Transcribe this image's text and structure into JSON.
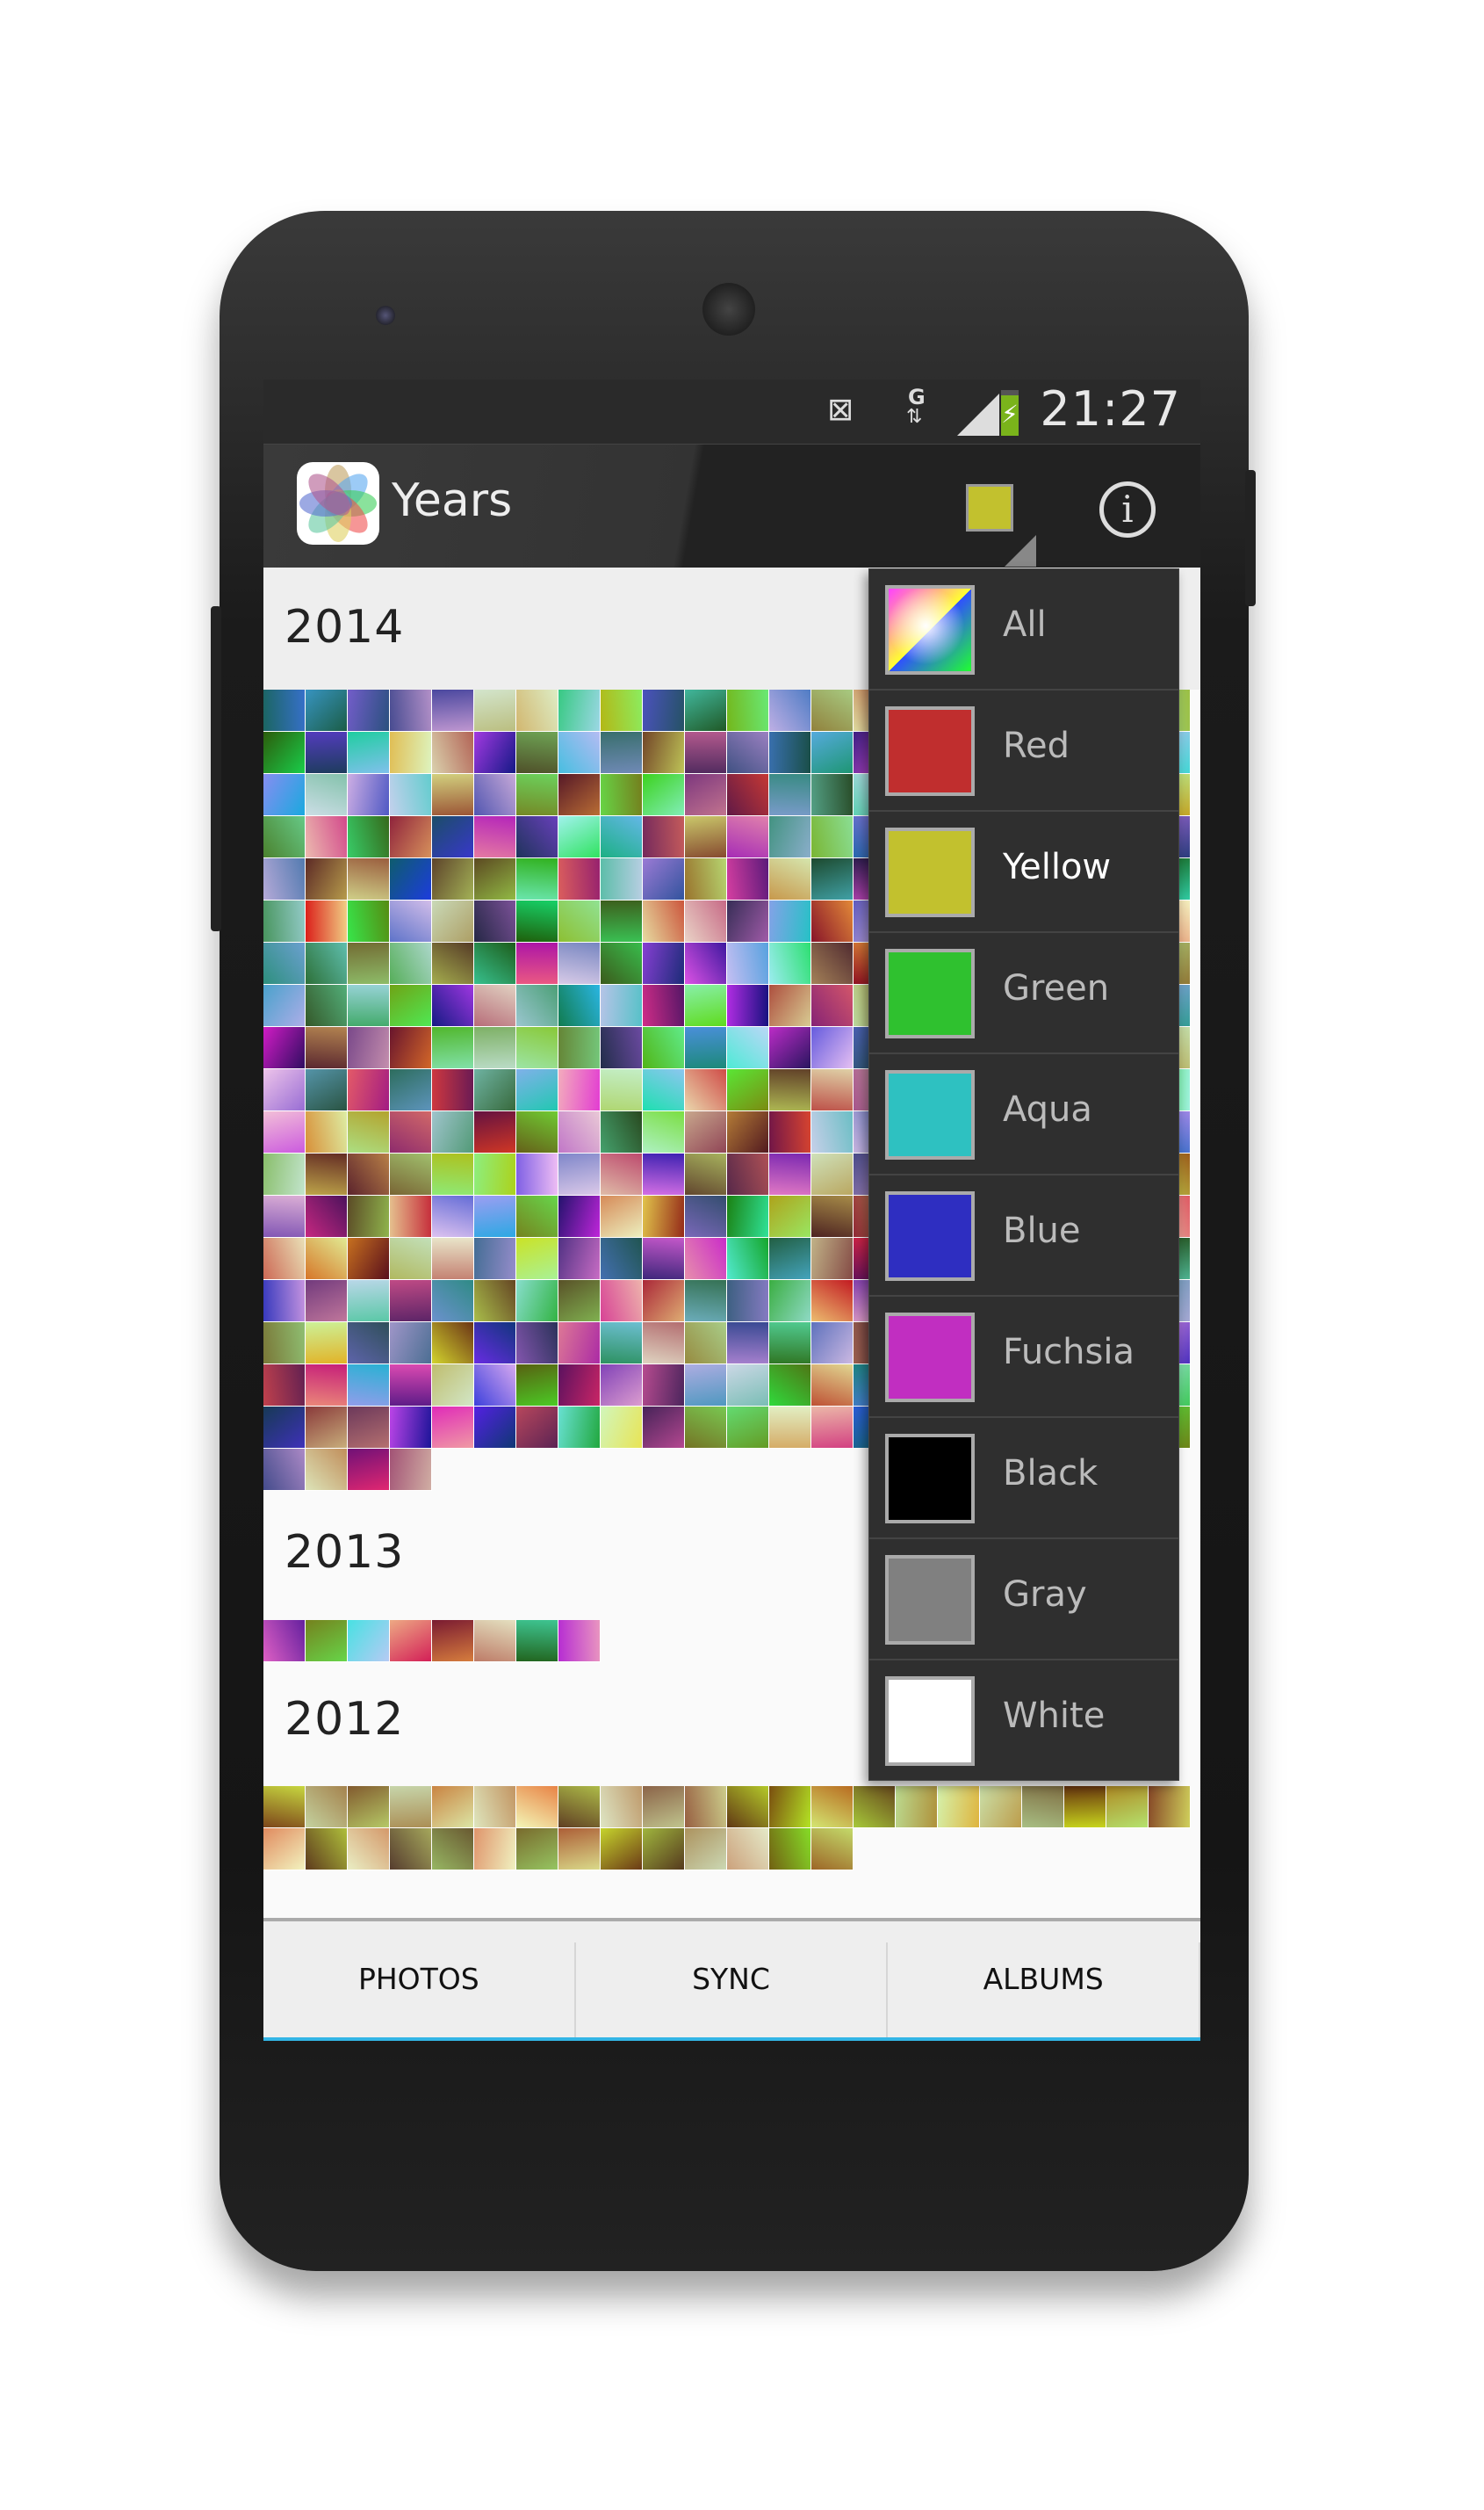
{
  "status_bar": {
    "time": "21:27",
    "network": "G",
    "icons": [
      "vibrate-mute-icon",
      "data-transfer-icon",
      "signal-icon",
      "battery-charging-icon"
    ]
  },
  "action_bar": {
    "title": "Years",
    "selected_color": "#c2c12e",
    "icons": [
      "app-logo-icon",
      "color-filter-icon",
      "info-icon"
    ]
  },
  "sections": [
    {
      "year": "2014"
    },
    {
      "year": "2013"
    },
    {
      "year": "2012"
    }
  ],
  "color_menu": {
    "selected": "Yellow",
    "items": [
      {
        "label": "All",
        "color": "gradient"
      },
      {
        "label": "Red",
        "color": "#c02e2e"
      },
      {
        "label": "Yellow",
        "color": "#c2c12e"
      },
      {
        "label": "Green",
        "color": "#2fc12f"
      },
      {
        "label": "Aqua",
        "color": "#2ec1c1"
      },
      {
        "label": "Blue",
        "color": "#2e2ec1"
      },
      {
        "label": "Fuchsia",
        "color": "#c12ec1"
      },
      {
        "label": "Black",
        "color": "#000000"
      },
      {
        "label": "Gray",
        "color": "#808080"
      },
      {
        "label": "White",
        "color": "#ffffff"
      }
    ]
  },
  "tabs": [
    {
      "label": "PHOTOS",
      "active": true
    },
    {
      "label": "SYNC",
      "active": false
    },
    {
      "label": "ALBUMS",
      "active": false
    }
  ],
  "accent": "#33b5e5"
}
